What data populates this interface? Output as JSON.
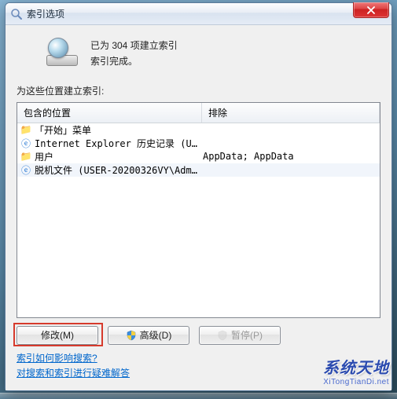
{
  "window": {
    "title": "索引选项"
  },
  "status": {
    "line1": "已为 304 项建立索引",
    "line2": "索引完成。"
  },
  "section_label": "为这些位置建立索引:",
  "listview": {
    "columns": {
      "col1": "包含的位置",
      "col2": "排除"
    },
    "rows": [
      {
        "icon": "folder",
        "c1": "「开始」菜单",
        "c2": ""
      },
      {
        "icon": "ie",
        "c1": "Internet Explorer 历史记录 (USE...",
        "c2": ""
      },
      {
        "icon": "folder",
        "c1": "用户",
        "c2": "AppData; AppData"
      },
      {
        "icon": "ie",
        "c1": "脱机文件 (USER-20200326VY\\Admin...",
        "c2": ""
      }
    ]
  },
  "buttons": {
    "modify": "修改(M)",
    "advanced": "高级(D)",
    "pause": "暂停(P)"
  },
  "links": {
    "l1": "索引如何影响搜索?",
    "l2": "对搜索和索引进行疑难解答"
  },
  "watermark": {
    "big": "系统天地",
    "small": "XiTongTianDi.net"
  }
}
